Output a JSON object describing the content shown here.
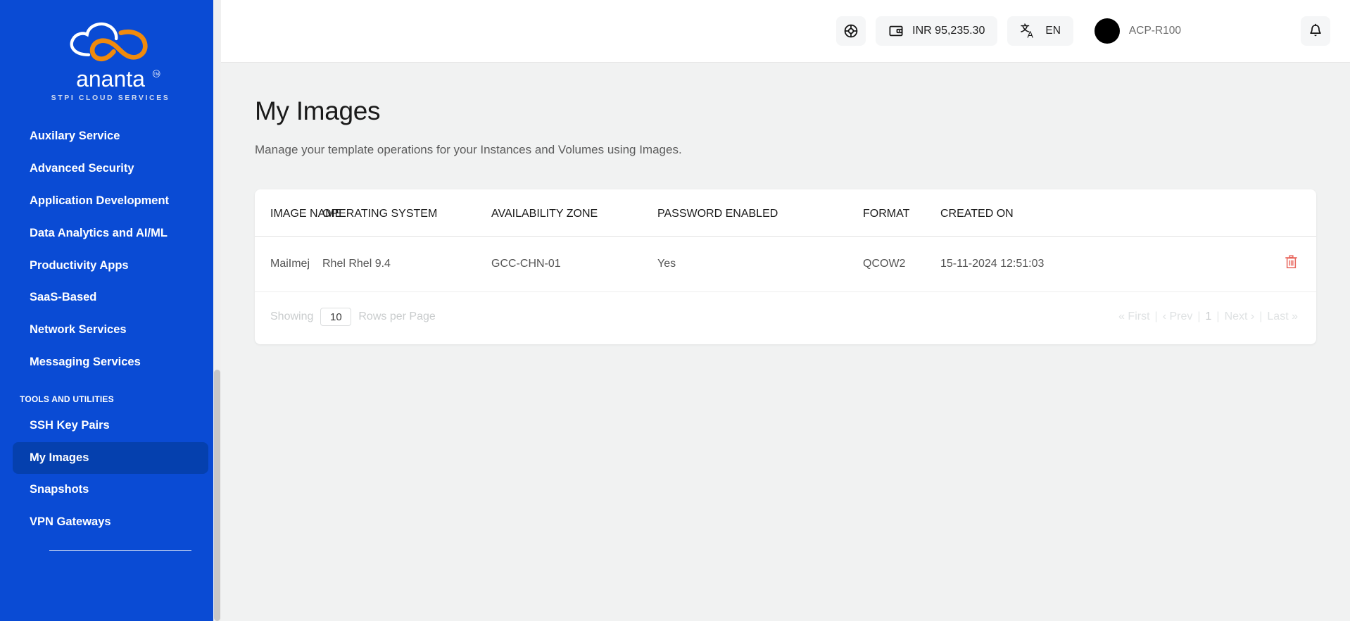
{
  "brand": {
    "name": "ananta",
    "tagline": "STPI CLOUD SERVICES",
    "logo_icon": "infinity-cloud-logo",
    "sidebar_color": "#0A4BD4",
    "active_color": "#0540AE",
    "accent_orange": "#F08A0C"
  },
  "sidebar": {
    "items": [
      {
        "label": "Auxilary Service",
        "active": false
      },
      {
        "label": "Advanced Security",
        "active": false
      },
      {
        "label": "Application Development",
        "active": false
      },
      {
        "label": "Data Analytics and AI/ML",
        "active": false
      },
      {
        "label": "Productivity Apps",
        "active": false
      },
      {
        "label": "SaaS-Based",
        "active": false
      },
      {
        "label": "Network Services",
        "active": false
      },
      {
        "label": "Messaging Services",
        "active": false
      }
    ],
    "section_title": "TOOLS AND UTILITIES",
    "tools": [
      {
        "label": "SSH Key Pairs",
        "active": false
      },
      {
        "label": "My Images",
        "active": true
      },
      {
        "label": "Snapshots",
        "active": false
      },
      {
        "label": "VPN Gateways",
        "active": false
      }
    ]
  },
  "topbar": {
    "support_icon": "globe-lifebuoy-icon",
    "wallet_icon": "wallet-icon",
    "balance": "INR 95,235.30",
    "translate_icon": "translate-icon",
    "language": "EN",
    "avatar_icon": "user-avatar",
    "user_name": "ACP-R100",
    "bell_icon": "bell-icon"
  },
  "page": {
    "title": "My Images",
    "subtitle": "Manage your template operations for your Instances and Volumes using Images."
  },
  "table": {
    "columns": [
      "IMAGE NAME",
      "OPERATING SYSTEM",
      "AVAILABILITY ZONE",
      "PASSWORD ENABLED",
      "FORMAT",
      "CREATED ON"
    ],
    "rows": [
      {
        "image_name": "MaiImej",
        "operating_system": "Rhel Rhel 9.4",
        "availability_zone": "GCC-CHN-01",
        "password_enabled": "Yes",
        "format": "QCOW2",
        "created_on": "15-11-2024 12:51:03",
        "delete_icon": "trash-icon",
        "delete_color": "#E8635A",
        "link_color": "#3DA1F2"
      }
    ]
  },
  "pagination": {
    "showing_label": "Showing",
    "rows_per_page_value": "10",
    "rows_per_page_label": "Rows per Page",
    "first": "« First",
    "prev": "‹ Prev",
    "current_page": "1",
    "next": "Next ›",
    "last": "Last »",
    "separator": "|"
  }
}
